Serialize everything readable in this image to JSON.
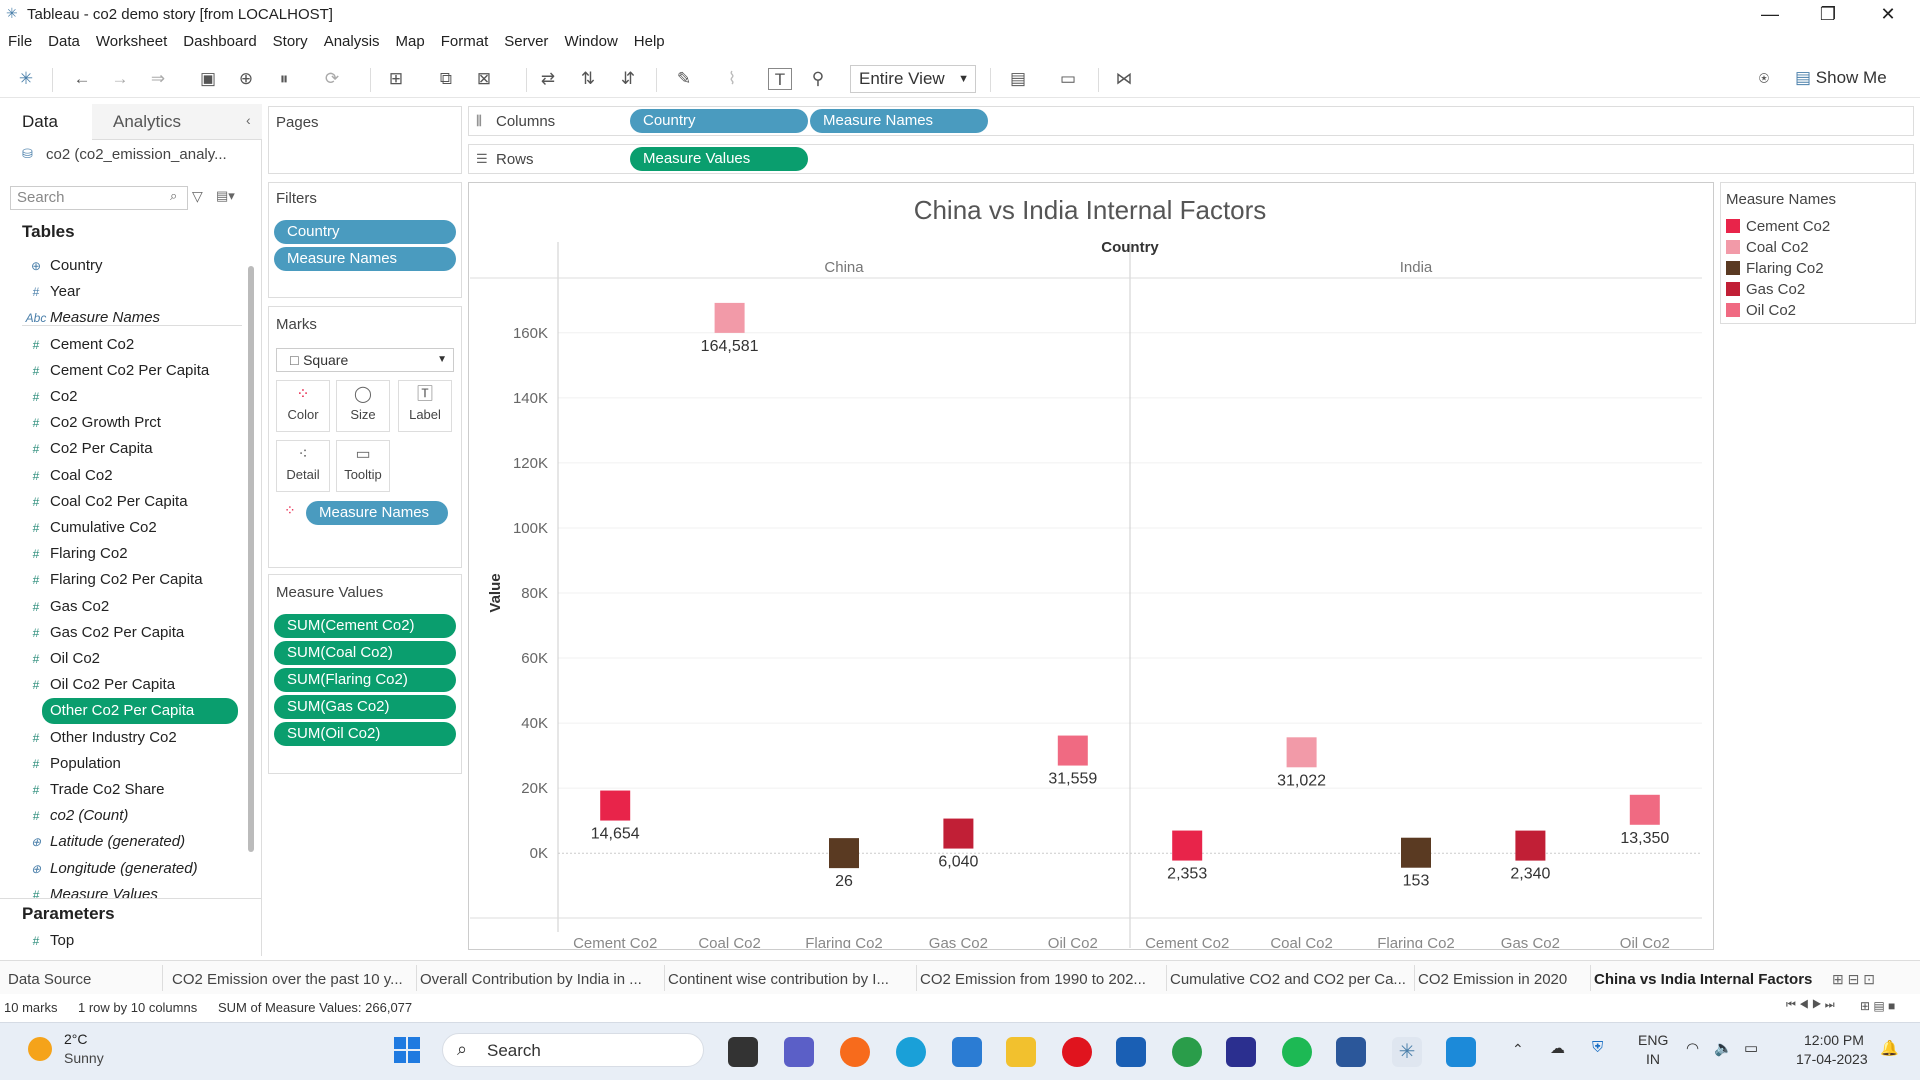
{
  "window": {
    "title": "Tableau - co2 demo story [from LOCALHOST]"
  },
  "menu": [
    "File",
    "Data",
    "Worksheet",
    "Dashboard",
    "Story",
    "Analysis",
    "Map",
    "Format",
    "Server",
    "Window",
    "Help"
  ],
  "toolbar": {
    "view_fit": "Entire View",
    "show_me": "Show Me"
  },
  "left_pane": {
    "tab_data": "Data",
    "tab_analytics": "Analytics",
    "datasource": "co2 (co2_emission_analy...",
    "search_placeholder": "Search",
    "tables_heading": "Tables",
    "fields": [
      {
        "icon": "globe",
        "label": "Country"
      },
      {
        "icon": "#",
        "label": "Year"
      },
      {
        "icon": "Abc",
        "label": "Measure Names"
      },
      {
        "icon": "#",
        "label": "Cement Co2"
      },
      {
        "icon": "#",
        "label": "Cement Co2 Per Capita"
      },
      {
        "icon": "#",
        "label": "Co2"
      },
      {
        "icon": "#",
        "label": "Co2 Growth Prct"
      },
      {
        "icon": "#",
        "label": "Co2 Per Capita"
      },
      {
        "icon": "#",
        "label": "Coal Co2"
      },
      {
        "icon": "#",
        "label": "Coal Co2 Per Capita"
      },
      {
        "icon": "#",
        "label": "Cumulative Co2"
      },
      {
        "icon": "#",
        "label": "Flaring Co2"
      },
      {
        "icon": "#",
        "label": "Flaring Co2 Per Capita"
      },
      {
        "icon": "#",
        "label": "Gas Co2"
      },
      {
        "icon": "#",
        "label": "Gas Co2 Per Capita"
      },
      {
        "icon": "#",
        "label": "Oil Co2"
      },
      {
        "icon": "#",
        "label": "Oil Co2 Per Capita"
      },
      {
        "icon": "#",
        "label": "Other Co2 Per Capita"
      },
      {
        "icon": "#",
        "label": "Other Industry Co2"
      },
      {
        "icon": "#",
        "label": "Population"
      },
      {
        "icon": "#",
        "label": "Trade Co2 Share"
      },
      {
        "icon": "#",
        "label": "co2 (Count)"
      },
      {
        "icon": "globe",
        "label": "Latitude (generated)"
      },
      {
        "icon": "globe",
        "label": "Longitude (generated)"
      },
      {
        "icon": "#",
        "label": "Measure Values"
      }
    ],
    "parameters_heading": "Parameters",
    "parameter": "Top"
  },
  "cards": {
    "pages": "Pages",
    "filters": "Filters",
    "filter_pills": [
      "Country",
      "Measure Names"
    ],
    "marks": "Marks",
    "mark_type": "Square",
    "mark_buttons": [
      "Color",
      "Size",
      "Label",
      "Detail",
      "Tooltip"
    ],
    "color_pill": "Measure Names",
    "measure_values": "Measure Values",
    "mv_pills": [
      "SUM(Cement Co2)",
      "SUM(Coal Co2)",
      "SUM(Flaring Co2)",
      "SUM(Gas Co2)",
      "SUM(Oil Co2)"
    ]
  },
  "shelves": {
    "columns_label": "Columns",
    "columns": [
      "Country",
      "Measure Names"
    ],
    "rows_label": "Rows",
    "rows": [
      "Measure Values"
    ]
  },
  "legend": {
    "title": "Measure Names",
    "items": [
      {
        "label": "Cement Co2",
        "color": "#e8244a"
      },
      {
        "label": "Coal Co2",
        "color": "#f29aa8"
      },
      {
        "label": "Flaring Co2",
        "color": "#5a3a22"
      },
      {
        "label": "Gas Co2",
        "color": "#c11f36"
      },
      {
        "label": "Oil Co2",
        "color": "#f06a82"
      }
    ]
  },
  "chart_data": {
    "type": "scatter",
    "title": "China vs India Internal Factors",
    "column_header": "Country",
    "ylabel": "Value",
    "ylim": [
      -15000,
      175000
    ],
    "yticks": [
      0,
      20000,
      40000,
      60000,
      80000,
      100000,
      120000,
      140000,
      160000
    ],
    "ytick_labels": [
      "0K",
      "20K",
      "40K",
      "60K",
      "80K",
      "100K",
      "120K",
      "140K",
      "160K"
    ],
    "panes": [
      {
        "country": "China",
        "categories": [
          "Cement Co2",
          "Coal Co2",
          "Flaring Co2",
          "Gas Co2",
          "Oil Co2"
        ],
        "values": [
          14654,
          164581,
          26,
          6040,
          31559
        ],
        "labels": [
          "14,654",
          "164,581",
          "26",
          "6,040",
          "31,559"
        ]
      },
      {
        "country": "India",
        "categories": [
          "Cement Co2",
          "Coal Co2",
          "Flaring Co2",
          "Gas Co2",
          "Oil Co2"
        ],
        "values": [
          2353,
          31022,
          153,
          2340,
          13350
        ],
        "labels": [
          "2,353",
          "31,022",
          "153",
          "2,340",
          "13,350"
        ]
      }
    ]
  },
  "sheet_tabs": [
    "Data Source",
    "CO2 Emission over the past 10 y...",
    "Overall Contribution by India in ...",
    "Continent wise contribution by I...",
    "CO2 Emission from 1990 to 202...",
    "Cumulative CO2 and CO2 per Ca...",
    "CO2 Emission in 2020",
    "China vs India Internal Factors"
  ],
  "status": {
    "marks": "10 marks",
    "rowcol": "1 row by 10 columns",
    "sum": "SUM of Measure Values: 266,077"
  },
  "taskbar": {
    "temp": "2°C",
    "weather": "Sunny",
    "search": "Search",
    "lang1": "ENG",
    "lang2": "IN",
    "time": "12:00 PM",
    "date": "17-04-2023"
  }
}
